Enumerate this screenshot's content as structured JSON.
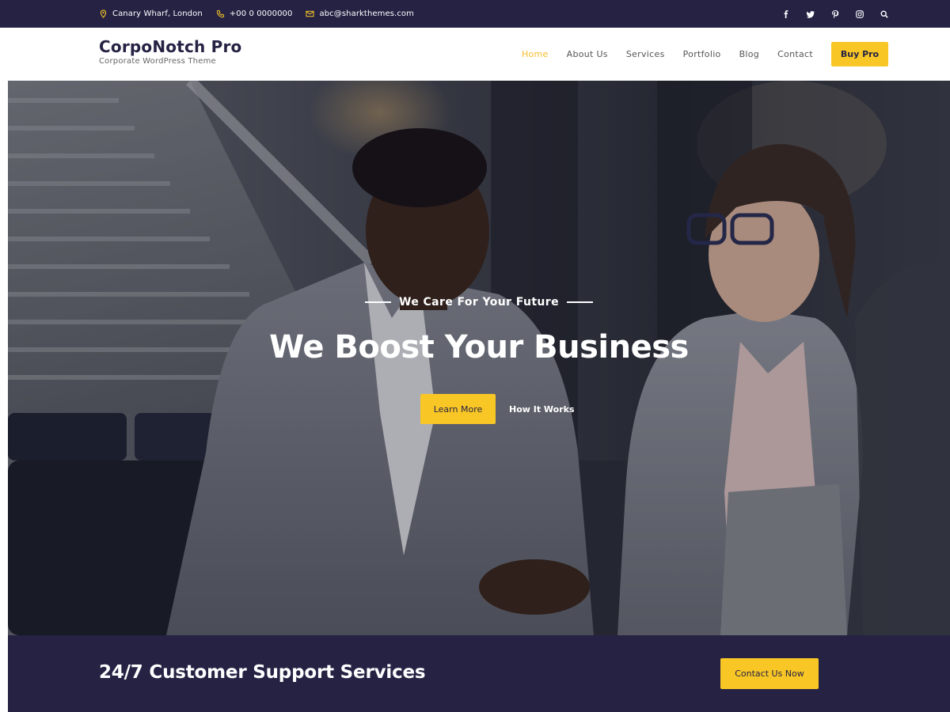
{
  "topbar": {
    "address": "Canary Wharf, London",
    "phone": "+00 0 0000000",
    "email": "abc@sharkthemes.com",
    "icons": [
      "map-pin-icon",
      "phone-icon",
      "envelope-icon"
    ],
    "social": [
      "facebook-icon",
      "twitter-icon",
      "pinterest-icon",
      "instagram-icon",
      "search-icon"
    ]
  },
  "header": {
    "site_title": "CorpoNotch Pro",
    "tagline": "Corporate WordPress Theme",
    "nav": [
      "Home",
      "About Us",
      "Services",
      "Portfolio",
      "Blog",
      "Contact"
    ],
    "active_nav": "Home",
    "buy_label": "Buy Pro"
  },
  "hero": {
    "subtitle": "We Care For Your Future",
    "headline": "We Boost Your Business",
    "primary_button": "Learn More",
    "secondary_link": "How It Works"
  },
  "cta": {
    "title": "24/7 Customer Support Services",
    "button": "Contact Us Now"
  },
  "colors": {
    "navy": "#252244",
    "accent": "#f9c725",
    "active_nav": "#f6be28",
    "white": "#ffffff"
  }
}
